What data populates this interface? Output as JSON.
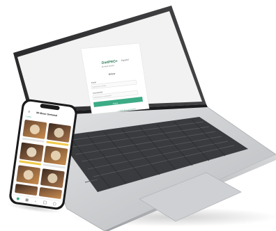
{
  "laptop": {
    "screen": {
      "login_card": {
        "logo_text": "DietPRO+",
        "logo_subtext": "Mi Meta Nutrión",
        "language_label": "Español",
        "heading": "Entrar",
        "email_label": "Email",
        "email_placeholder": "Introduce tu email",
        "password_label": "Contraseña",
        "password_placeholder": "Introduce tu contraseña",
        "submit_label": "Entrar",
        "footer_link": "¿Olvidaste tu contraseña?"
      }
    }
  },
  "phone": {
    "header_title": "Mi Menú Semanal",
    "day_label": "Lunes",
    "tabbar": [
      "home-icon",
      "list-icon",
      "plus-icon",
      "calendar-icon",
      "user-icon"
    ]
  },
  "colors": {
    "brand_green": "#3dab85",
    "laptop_body": "#c9cacc",
    "screen_bg": "#f4f4f4"
  }
}
